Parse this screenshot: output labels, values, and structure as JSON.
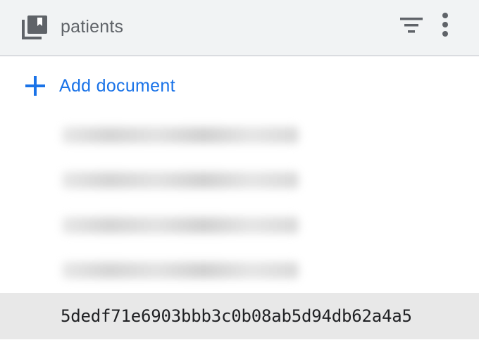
{
  "collection": {
    "title": "patients",
    "icon": "collection-icon",
    "filter_icon": "filter-icon",
    "more_icon": "more-vert-icon"
  },
  "add_document": {
    "label": "Add document",
    "icon": "plus-icon",
    "color": "#1a73e8"
  },
  "documents": [
    {
      "id": "",
      "redacted": true
    },
    {
      "id": "",
      "redacted": true
    },
    {
      "id": "",
      "redacted": true
    },
    {
      "id": "",
      "redacted": true
    },
    {
      "id": "5dedf71e6903bbb3c0b08ab5d94db62a4a5",
      "redacted": false,
      "selected": true
    }
  ],
  "colors": {
    "header_bg": "#f1f3f4",
    "selected_row_bg": "#e8e8e8",
    "icon_gray": "#5f6368"
  }
}
